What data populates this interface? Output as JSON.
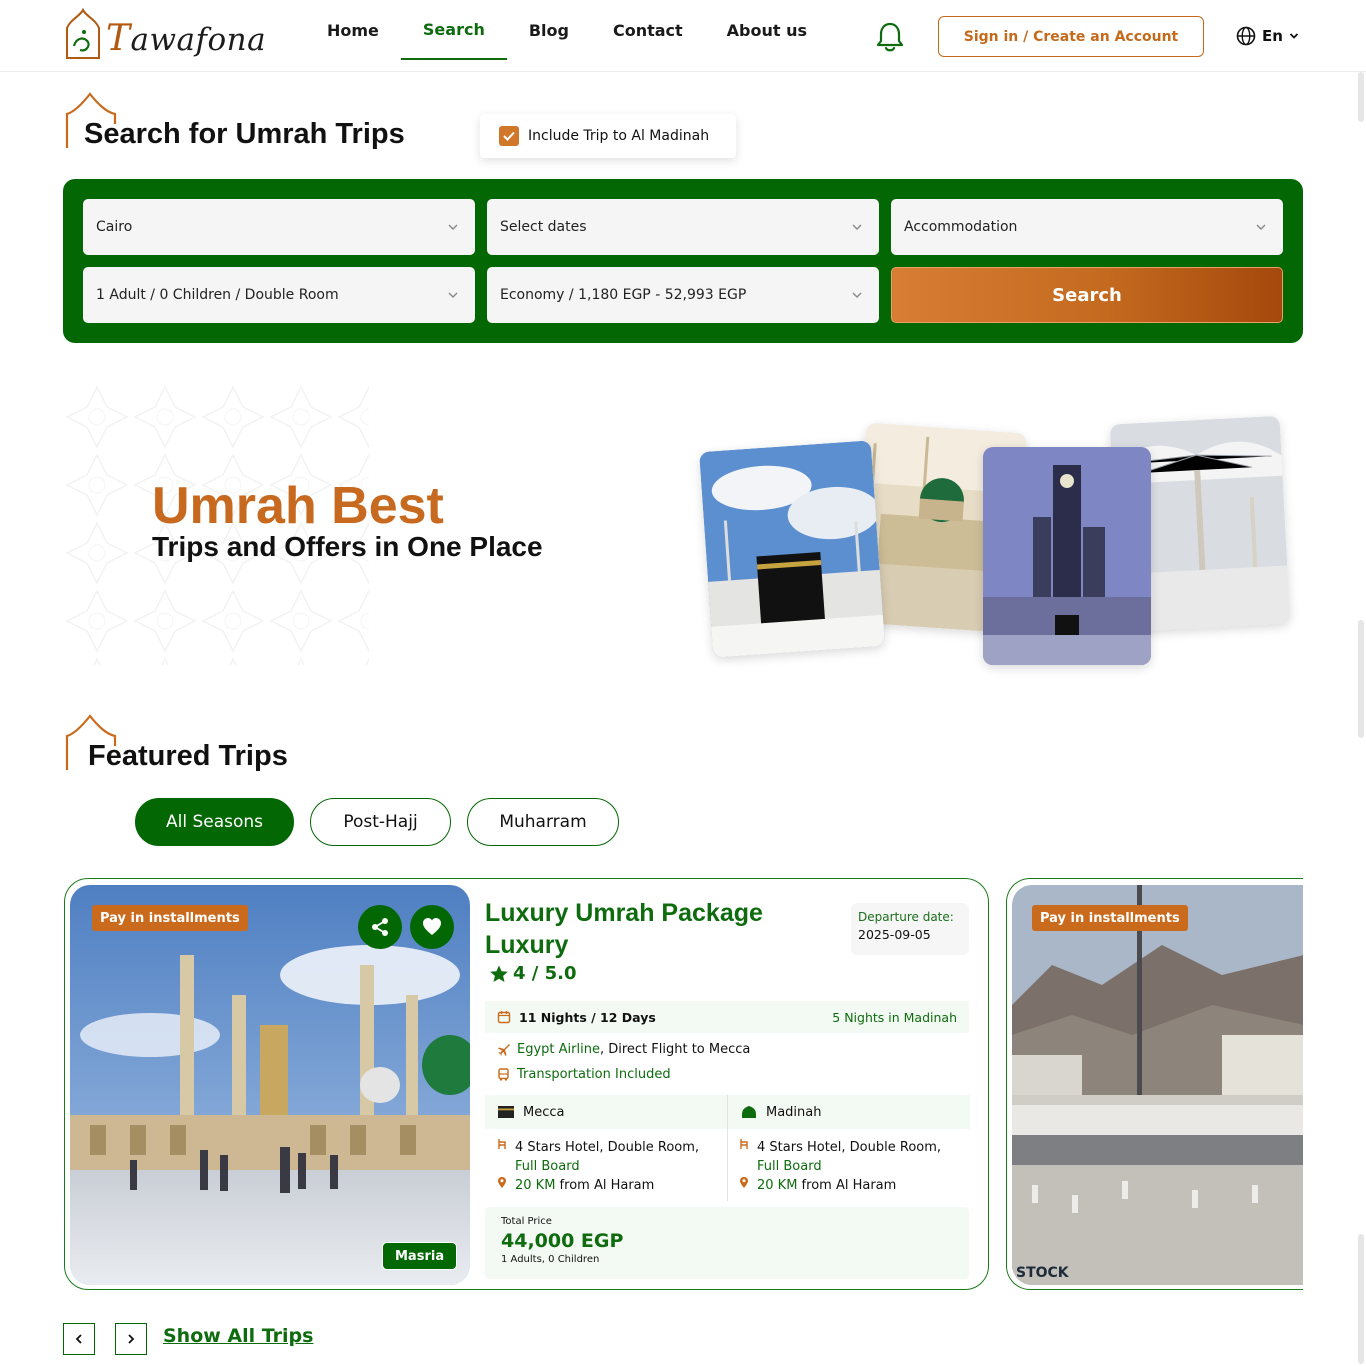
{
  "header": {
    "brand": {
      "first": "T",
      "rest": "awafona"
    },
    "nav": [
      {
        "label": "Home",
        "active": false
      },
      {
        "label": "Search",
        "active": true
      },
      {
        "label": "Blog",
        "active": false
      },
      {
        "label": "Contact",
        "active": false
      },
      {
        "label": "About us",
        "active": false
      }
    ],
    "signin_label": "Sign in / Create an Account",
    "lang_label": "En"
  },
  "search": {
    "title": "Search for Umrah Trips",
    "madinah_checkbox": {
      "label": "Include Trip to Al Madinah",
      "checked": true
    },
    "fields": {
      "city": "Cairo",
      "dates": "Select dates",
      "accommodation": "Accommodation",
      "guests": "1 Adult / 0 Children / Double Room",
      "budget": "Economy / 1,180 EGP - 52,993 EGP"
    },
    "button_label": "Search"
  },
  "hero": {
    "title": "Umrah Best",
    "subtitle": "Trips and Offers in One Place"
  },
  "featured": {
    "title": "Featured Trips",
    "tabs": [
      {
        "label": "All Seasons",
        "active": true
      },
      {
        "label": "Post-Hajj",
        "active": false
      },
      {
        "label": "Muharram",
        "active": false
      }
    ],
    "cards": [
      {
        "badge": "Pay in installments",
        "agency": "Masria",
        "title": "Luxury Umrah Package Luxury",
        "rating": "4 / 5.0",
        "departure_label": "Departure date:",
        "departure_date": "2025-09-05",
        "duration": "11 Nights / 12 Days",
        "madinah_nights": "5 Nights in Madinah",
        "airline": "Egypt Airline",
        "flight": ", Direct Flight to Mecca",
        "transport": "Transportation Included",
        "mecca": {
          "city": "Mecca",
          "hotel": "4 Stars Hotel, Double Room,",
          "board": "Full Board",
          "distance": "20 KM",
          "distance_suffix": " from Al Haram"
        },
        "madinah": {
          "city": "Madinah",
          "hotel": "4 Stars Hotel, Double Room,",
          "board": "Full Board",
          "distance": "20 KM",
          "distance_suffix": " from Al Haram"
        },
        "price_label": "Total Price",
        "price": "44,000 EGP",
        "travellers": "1 Adults, 0 Children"
      },
      {
        "badge": "Pay in installments",
        "watermark": "STOCK"
      }
    ],
    "show_all_label": "Show All Trips"
  },
  "colors": {
    "brand_green": "#036703",
    "accent_orange": "#c96a1c",
    "text_green": "#0e6b0e"
  },
  "icons": [
    "bell-icon",
    "globe-icon",
    "chevron-down-icon",
    "check-icon",
    "share-icon",
    "heart-icon",
    "star-icon",
    "calendar-icon",
    "plane-icon",
    "bus-icon",
    "kaaba-icon",
    "mosque-dome-icon",
    "hotel-icon",
    "location-pin-icon",
    "chevron-left-icon",
    "chevron-right-icon"
  ]
}
